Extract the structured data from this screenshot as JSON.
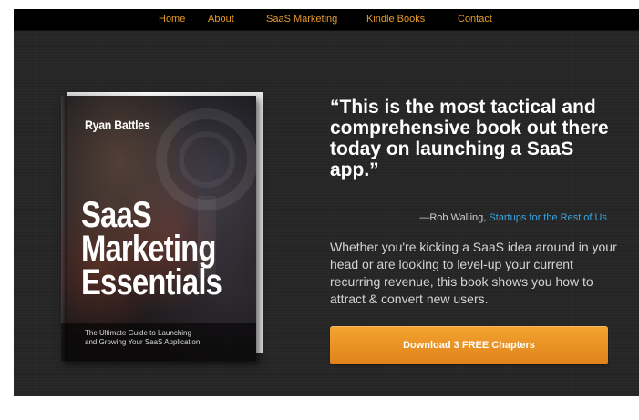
{
  "nav": {
    "items": [
      {
        "label": "Home"
      },
      {
        "label": "About"
      },
      {
        "label": "SaaS Marketing"
      },
      {
        "label": "Kindle Books"
      },
      {
        "label": "Contact"
      }
    ]
  },
  "book": {
    "author": "Ryan Battles",
    "title_lines": [
      "SaaS",
      "Marketing",
      "Essentials"
    ],
    "subtitle_lines": [
      "The Ultimate Guide to Launching",
      "and Growing Your SaaS Application"
    ]
  },
  "hero": {
    "quote": "“This is the most tactical and comprehensive book out there today on launching a SaaS app.”",
    "attribution_prefix": "—Rob Walling, ",
    "attribution_link": "Startups for the Rest of Us",
    "description": "Whether you're kicking a SaaS idea around in your head or are looking to level-up your current recurring revenue, this book shows you how to attract & convert new users.",
    "cta_label": "Download 3 FREE Chapters"
  },
  "colors": {
    "accent": "#e59a2a",
    "link": "#3aa6e0",
    "background": "#262626",
    "nav_background": "#000000",
    "cta_top": "#f3a430",
    "cta_bottom": "#e0821a"
  }
}
